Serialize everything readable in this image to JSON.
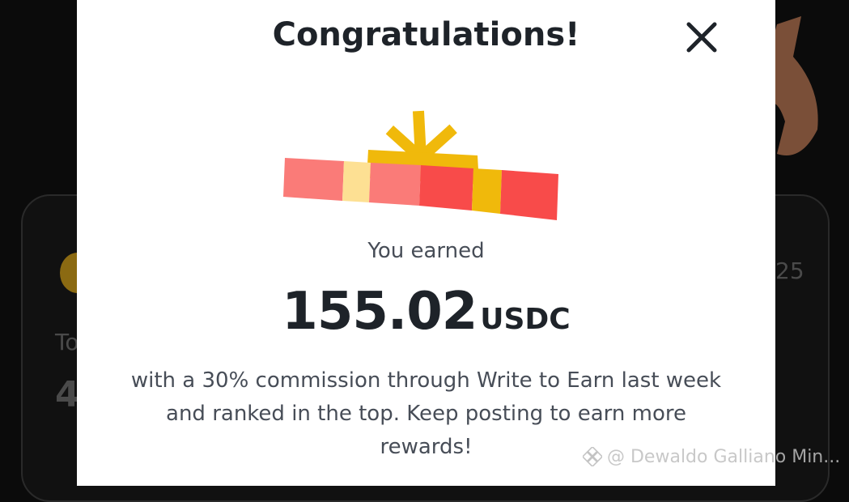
{
  "background": {
    "left_text": "To",
    "left_number": "4",
    "right_text": "25"
  },
  "modal": {
    "title": "Congratulations!",
    "earned_label": "You earned",
    "amount": "155.02",
    "currency": "USDC",
    "message": "with a 30% commission through Write to Earn last week and ranked in the top. Keep posting to earn more rewards!"
  },
  "watermark": {
    "text": "@ Dewaldo Galliano Min..."
  },
  "icons": {
    "close": "close-icon",
    "gift": "gift-icon",
    "watermark_logo": "binance-logo-icon"
  }
}
